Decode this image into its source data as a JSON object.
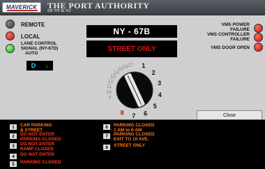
{
  "header": {
    "logo_text": "MAVERICK",
    "title": "THE PORT AUTHORITY",
    "subtitle": "OF NY & NJ"
  },
  "controls": {
    "remote_label": "REMOTE",
    "local_label": "LOCAL",
    "lane_control_label_1": "LANE CONTROL",
    "lane_control_label_2": "SIGNAL (NY-67D)",
    "lane_control_label_3": "AUTO",
    "d_label": "D",
    "d_arrow": "↓"
  },
  "sign": {
    "name": "NY - 67B",
    "message": "STREET ONLY"
  },
  "vms": {
    "power_label_1": "VMS POWER",
    "power_label_2": "FAILURE",
    "controller_label_1": "VMS CONTROLLER",
    "controller_label_2": "FAILURE",
    "door_label": "VMS DOOR OPEN"
  },
  "dial": {
    "numbers": [
      "1",
      "2",
      "3",
      "4",
      "5",
      "6",
      "7",
      "8",
      "9",
      "10",
      "11",
      "12",
      "13",
      "14",
      "15",
      "16",
      "17"
    ],
    "selected": "8"
  },
  "close_label": "Close",
  "legend": [
    {
      "num": "1",
      "line1": "CAR PARKING",
      "line2": "& STREET"
    },
    {
      "num": "2",
      "line1": "DO NOT ENTER",
      "line2": "PARKING CLOSED"
    },
    {
      "num": "3",
      "line1": "DO NOT ENTER",
      "line2": "RAMP CLOSED"
    },
    {
      "num": "4",
      "line1": "DO NOT ENTER",
      "line2": ""
    },
    {
      "num": "5",
      "line1": "PARKING CLOSED",
      "line2": ""
    },
    {
      "num": "6",
      "line1": "PARKING CLOSED",
      "line2": "1 AM to 6 AM"
    },
    {
      "num": "7",
      "line1": "PARKING CLOSED",
      "line2": "EXIT TO 10 AVE."
    },
    {
      "num": "8",
      "line1": "STREET ONLY",
      "line2": ""
    }
  ],
  "colors": {
    "lamp_red": "#e01010",
    "lamp_green": "#2ee02e",
    "legend_text": "#ff3a1a"
  }
}
